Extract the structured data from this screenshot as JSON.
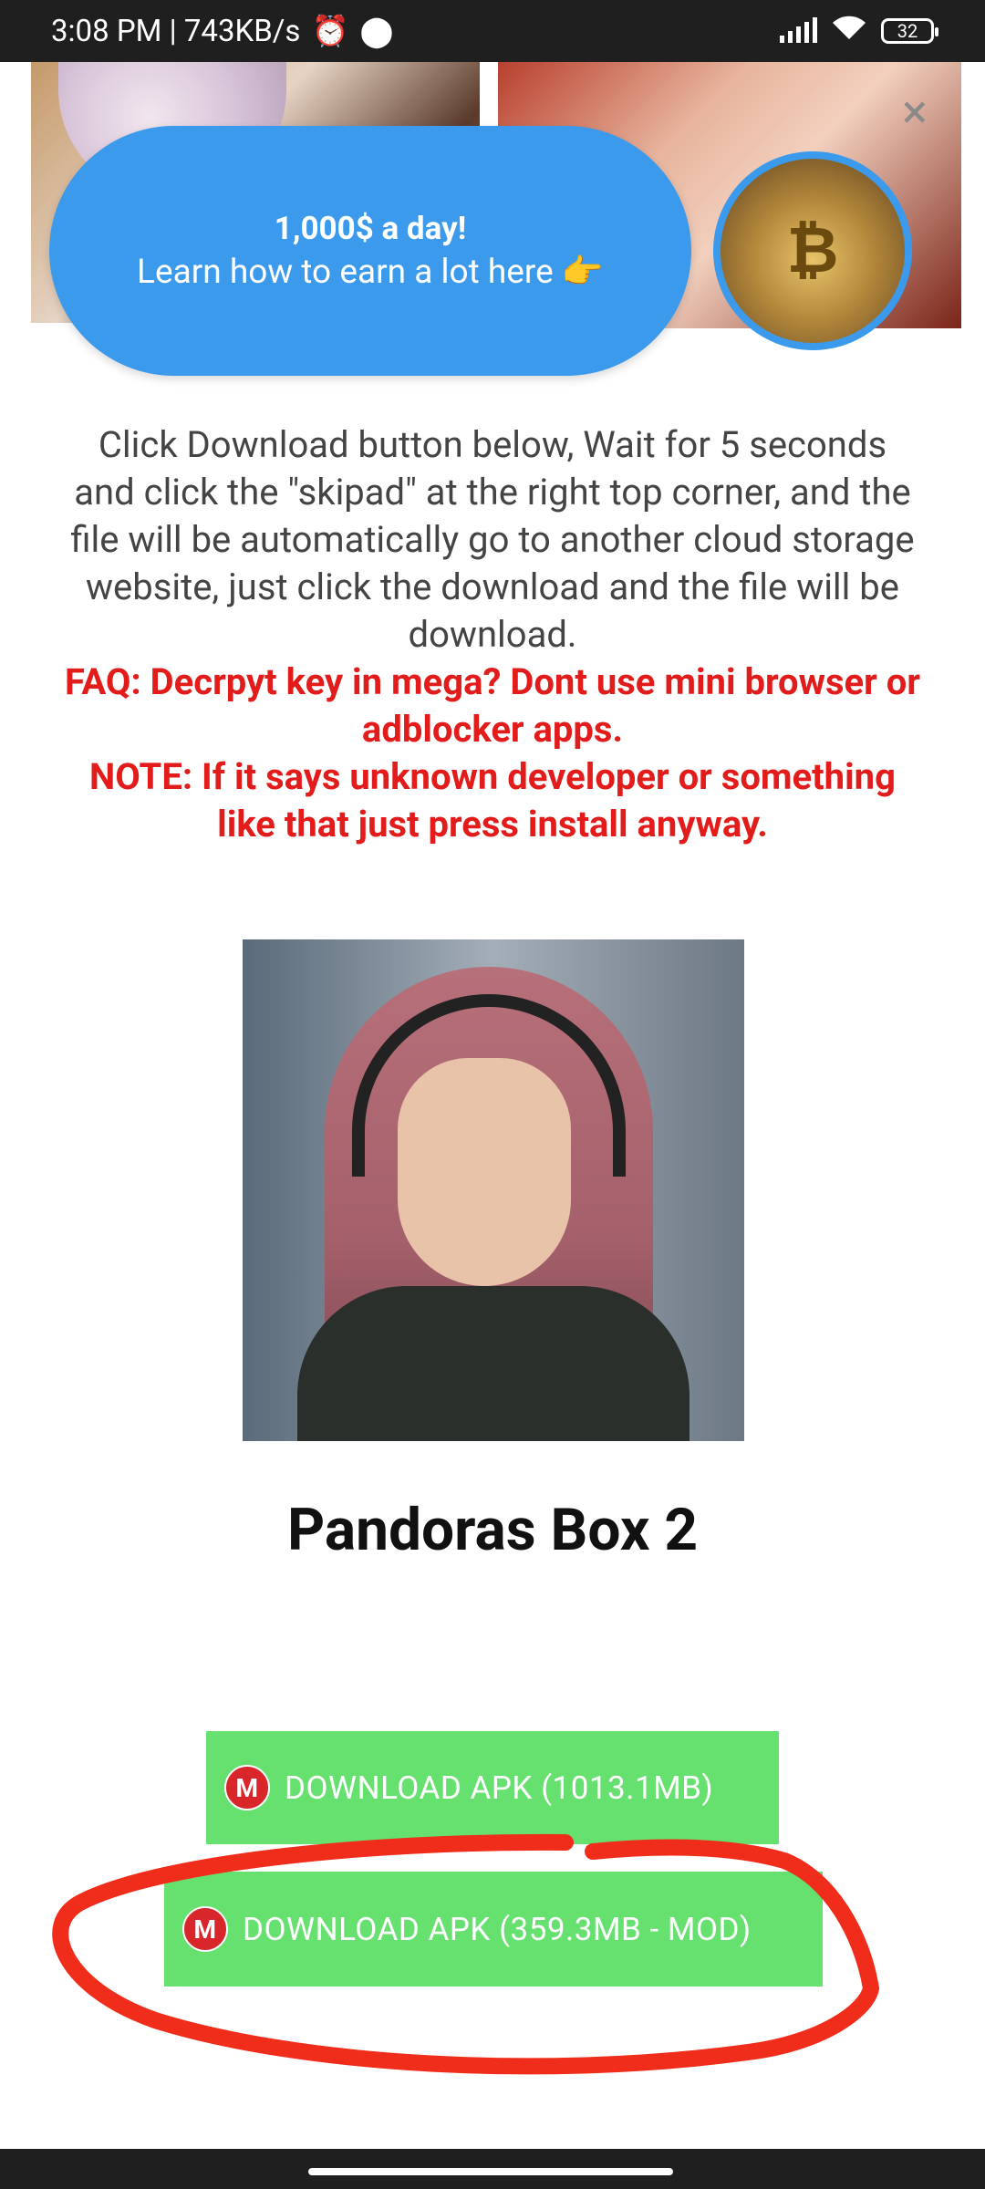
{
  "status_bar": {
    "time_speed": "3:08 PM | 743KB/s",
    "battery": "32"
  },
  "promo": {
    "title": "1,000$ a day!",
    "subtitle": "Learn how to earn a lot here 👉"
  },
  "instructions": {
    "body": "Click Download button below, Wait for 5 seconds and click the \"skipad\" at the right top corner, and the file will be automatically go to another cloud storage website, just click the download and the file will be download.",
    "faq": "FAQ: Decrpyt key in mega? Dont use mini browser or adblocker apps.",
    "note": "NOTE: If it says unknown developer or something like that just press install anyway."
  },
  "game": {
    "title": "Pandoras Box 2"
  },
  "downloads": {
    "primary_label": "DOWNLOAD APK (1013.1MB)",
    "mod_label": "DOWNLOAD APK (359.3MB - MOD)"
  },
  "colors": {
    "promo_blue": "#3b9aec",
    "download_green": "#66e06f",
    "warning_red": "#e21b1b",
    "mega_red": "#d9262b"
  }
}
